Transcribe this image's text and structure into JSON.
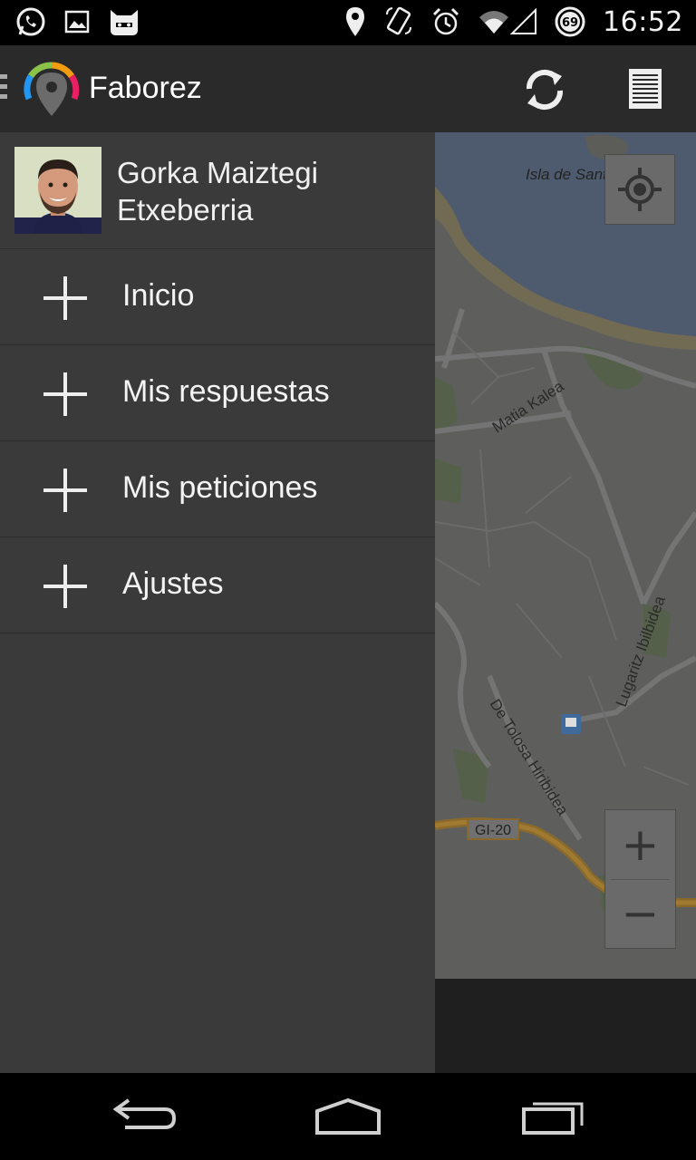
{
  "status_bar": {
    "time": "16:52",
    "battery": "69",
    "left_icons": [
      "whatsapp-icon",
      "gallery-icon",
      "cyanogenmod-icon"
    ],
    "right_icons": [
      "location-icon",
      "rotate-icon",
      "alarm-icon",
      "wifi-icon",
      "signal-icon",
      "battery-icon"
    ]
  },
  "action_bar": {
    "title": "Faborez"
  },
  "drawer": {
    "user_name_line1": "Gorka Maiztegi",
    "user_name_line2": "Etxeberria",
    "items": [
      {
        "label": "Inicio"
      },
      {
        "label": "Mis respuestas"
      },
      {
        "label": "Mis peticiones"
      },
      {
        "label": "Ajustes"
      }
    ]
  },
  "map": {
    "labels": {
      "island": "Isla de Santa Clara",
      "street1": "Matia Kalea",
      "street2": "De Tolosa Hiribidea",
      "street3": "Lugaritz Ibilbidea",
      "road": "GI-20"
    },
    "zoom_in": "+",
    "zoom_out": "−"
  },
  "colors": {
    "drawer_bg": "#3a3a3a",
    "action_bar_bg": "#2a2a2a",
    "map_water": "#4e5b6e",
    "map_land": "#5e5e5c"
  }
}
